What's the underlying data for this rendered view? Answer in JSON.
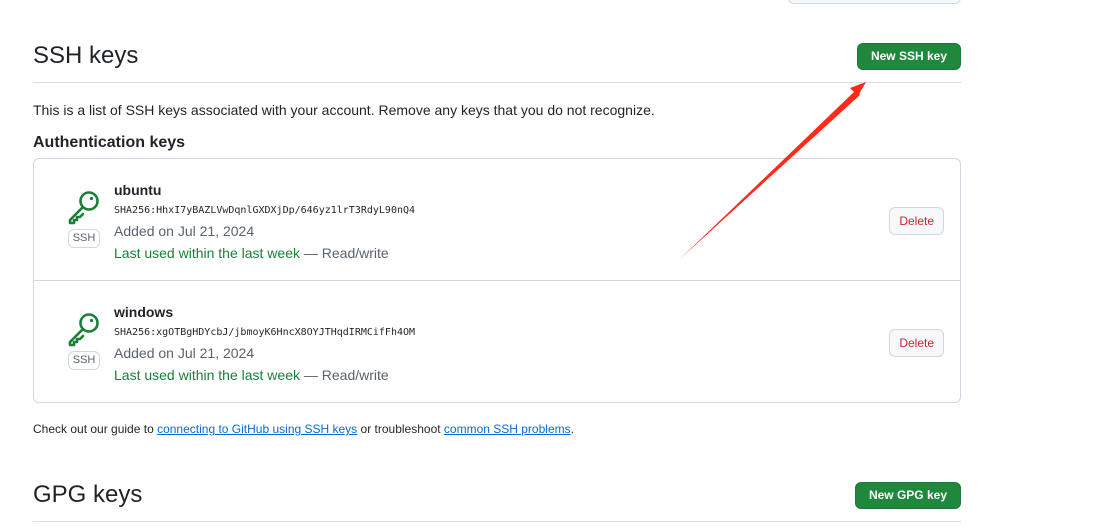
{
  "ssh": {
    "title": "SSH keys",
    "new_button": "New SSH key",
    "description": "This is a list of SSH keys associated with your account. Remove any keys that you do not recognize.",
    "auth_heading": "Authentication keys",
    "keys": [
      {
        "name": "ubuntu",
        "fingerprint": "SHA256:HhxI7yBAZLVwDqnlGXDXjDp/646yz1lrT3RdyL90nQ4",
        "added": "Added on Jul 21, 2024",
        "last_used": "Last used within the last week",
        "access": " — Read/write",
        "badge": "SSH",
        "delete_label": "Delete"
      },
      {
        "name": "windows",
        "fingerprint": "SHA256:xgOTBgHDYcbJ/jbmoyK6HncX8OYJTHqdIRMCifFh4OM",
        "added": "Added on Jul 21, 2024",
        "last_used": "Last used within the last week",
        "access": " — Read/write",
        "badge": "SSH",
        "delete_label": "Delete"
      }
    ],
    "guide": {
      "prefix": "Check out our guide to ",
      "link1": "connecting to GitHub using SSH keys",
      "middle": " or troubleshoot ",
      "link2": "common SSH problems",
      "suffix": "."
    }
  },
  "gpg": {
    "title": "GPG keys",
    "new_button": "New GPG key"
  },
  "colors": {
    "primary_button": "#1f883d",
    "key_icon": "#1a7f37",
    "danger": "#d1242f",
    "link": "#0969da",
    "annotation_arrow": "#ff2a1a"
  }
}
